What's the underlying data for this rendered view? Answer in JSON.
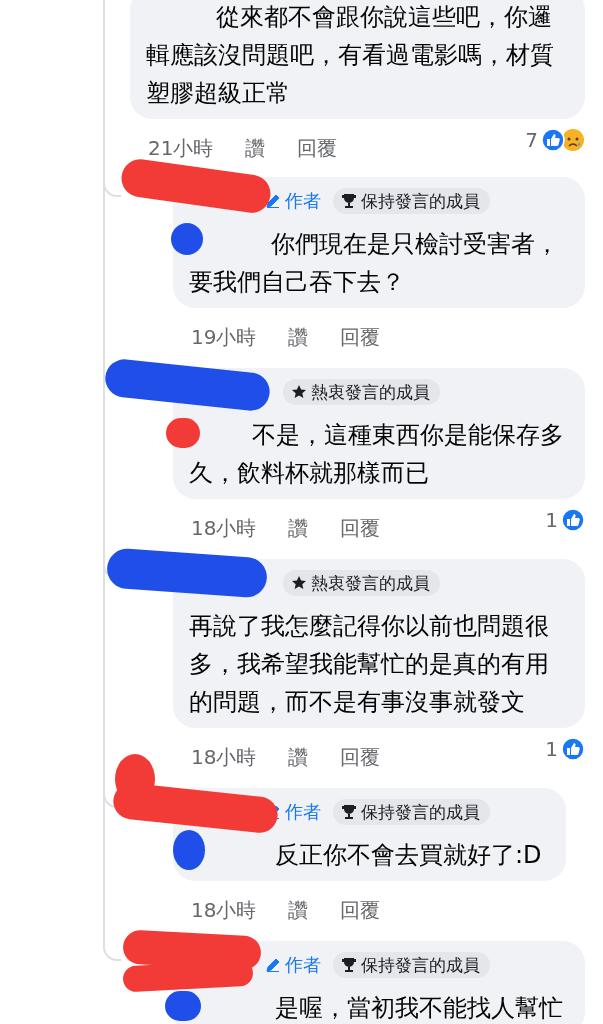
{
  "comment": {
    "text": "從來都不會跟你說這些吧，你邏輯應該沒問題吧，有看過電影嗎，材質塑膠超級正常",
    "time": "21小時",
    "like": "讚",
    "reply": "回覆",
    "reaction_count": "7",
    "reactions": [
      {
        "kind": "like"
      },
      {
        "kind": "sad"
      }
    ]
  },
  "replies": [
    {
      "author_tag": "作者",
      "badge": {
        "kind": "trophy",
        "label": "保持發言的成員"
      },
      "text": "你們現在是只檢討受害者，要我們自己吞下去？",
      "time": "19小時",
      "like": "讚",
      "reply": "回覆"
    },
    {
      "badge": {
        "kind": "star",
        "label": "熱衷發言的成員"
      },
      "text": "不是，這種東西你是能保存多久，飲料杯就那樣而已",
      "time": "18小時",
      "like": "讚",
      "reply": "回覆",
      "reaction_count": "1",
      "reactions": [
        {
          "kind": "like"
        }
      ]
    },
    {
      "badge": {
        "kind": "star",
        "label": "熱衷發言的成員"
      },
      "text": "再說了我怎麼記得你以前也問題很多，我希望我能幫忙的是真的有用的問題，而不是有事沒事就發文",
      "time": "18小時",
      "like": "讚",
      "reply": "回覆",
      "reaction_count": "1",
      "reactions": [
        {
          "kind": "like"
        }
      ]
    },
    {
      "author_tag": "作者",
      "badge": {
        "kind": "trophy",
        "label": "保持發言的成員"
      },
      "text": "反正你不會去買就好了:D",
      "time": "18小時",
      "like": "讚",
      "reply": "回覆"
    },
    {
      "author_tag": "作者",
      "badge": {
        "kind": "trophy",
        "label": "保持發言的成員"
      },
      "text": "是喔，當初我不能找人幫忙"
    }
  ]
}
